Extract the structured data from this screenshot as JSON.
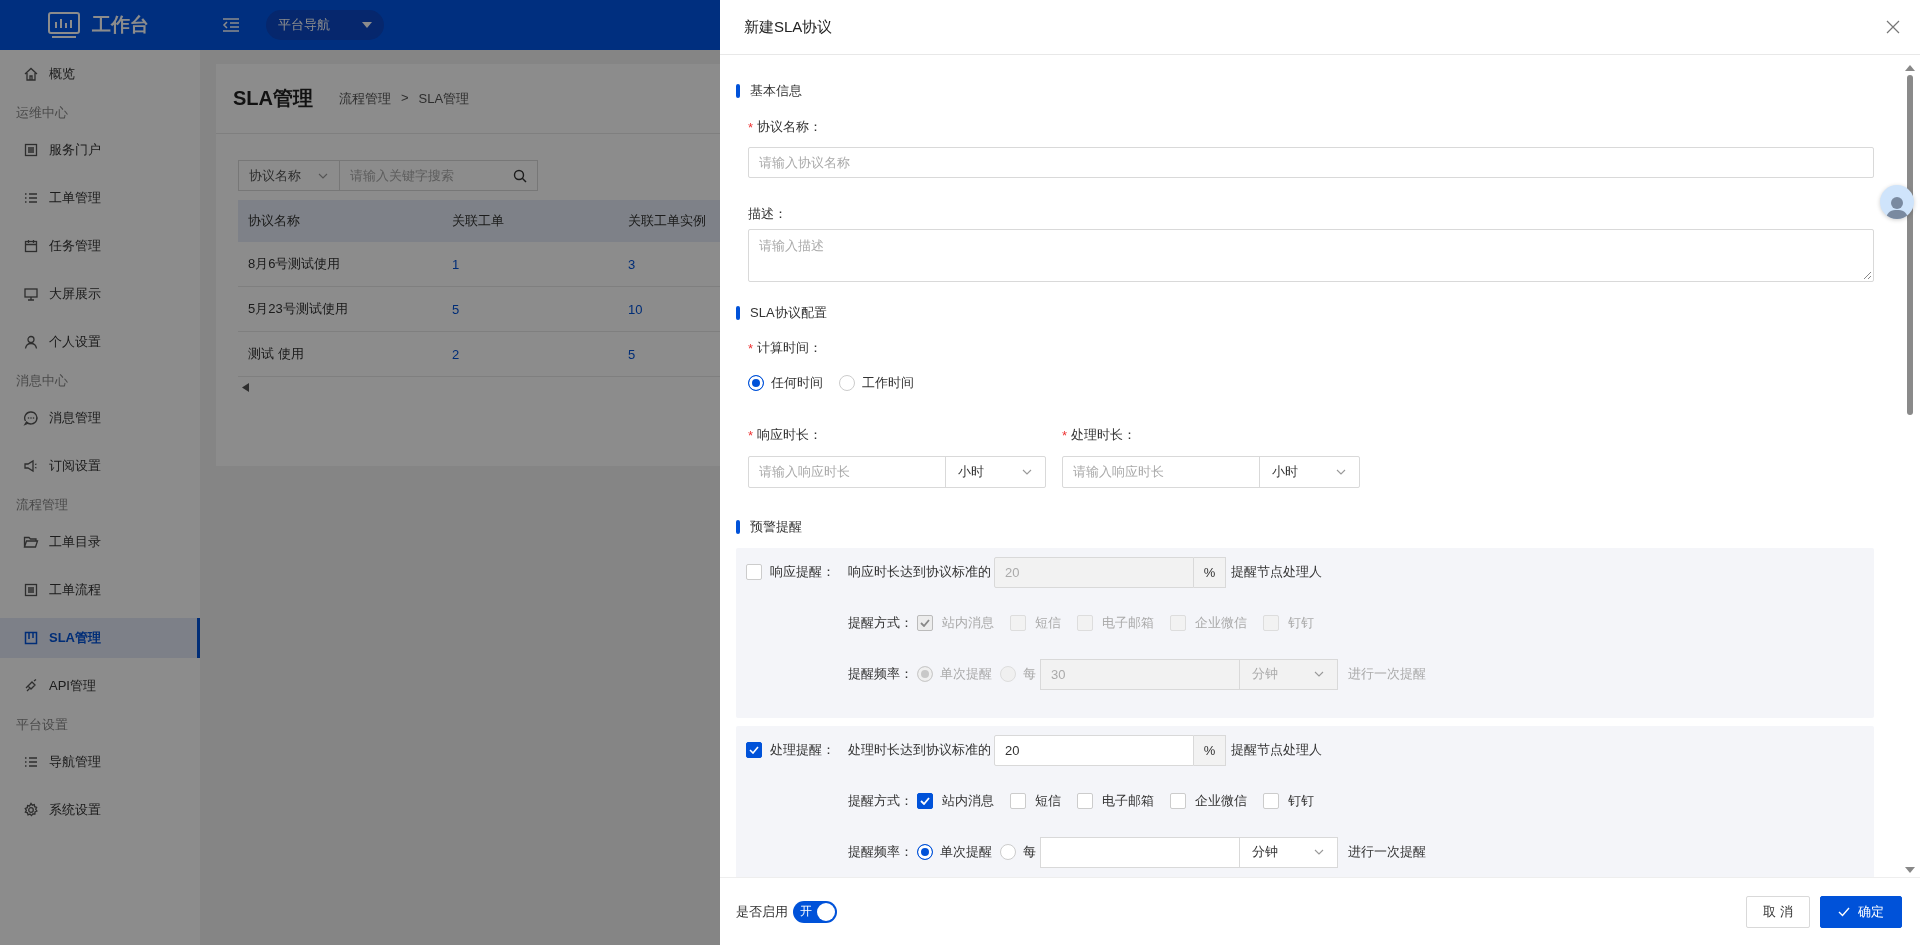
{
  "header": {
    "logo": "工作台",
    "nav_dropdown": "平台导航"
  },
  "sidebar": {
    "items": [
      {
        "kind": "item",
        "label": "概览",
        "selected": false
      },
      {
        "kind": "group",
        "label": "运维中心"
      },
      {
        "kind": "item",
        "label": "服务门户",
        "selected": false
      },
      {
        "kind": "item",
        "label": "工单管理",
        "selected": false
      },
      {
        "kind": "item",
        "label": "任务管理",
        "selected": false
      },
      {
        "kind": "item",
        "label": "大屏展示",
        "selected": false
      },
      {
        "kind": "item",
        "label": "个人设置",
        "selected": false
      },
      {
        "kind": "group",
        "label": "消息中心"
      },
      {
        "kind": "item",
        "label": "消息管理",
        "selected": false
      },
      {
        "kind": "item",
        "label": "订阅设置",
        "selected": false
      },
      {
        "kind": "group",
        "label": "流程管理"
      },
      {
        "kind": "item",
        "label": "工单目录",
        "selected": false
      },
      {
        "kind": "item",
        "label": "工单流程",
        "selected": false
      },
      {
        "kind": "item",
        "label": "SLA管理",
        "selected": true
      },
      {
        "kind": "item",
        "label": "API管理",
        "selected": false
      },
      {
        "kind": "group",
        "label": "平台设置"
      },
      {
        "kind": "item",
        "label": "导航管理",
        "selected": false
      },
      {
        "kind": "item",
        "label": "系统设置",
        "selected": false
      }
    ]
  },
  "page": {
    "title": "SLA管理",
    "breadcrumb": [
      "流程管理",
      "SLA管理"
    ],
    "breadcrumb_separator": ">",
    "search": {
      "field": "协议名称",
      "placeholder": "请输入关键字搜索"
    },
    "table": {
      "columns": [
        "协议名称",
        "关联工单",
        "关联工单实例"
      ],
      "rows": [
        [
          "8月6号测试使用",
          "1",
          "3"
        ],
        [
          "5月23号测试使用",
          "5",
          "10"
        ],
        [
          "测试 使用",
          "2",
          "5"
        ]
      ]
    }
  },
  "drawer": {
    "title": "新建SLA协议",
    "basic": {
      "title": "基本信息",
      "name_required": "*",
      "name_label": "协议名称：",
      "name_placeholder": "请输入协议名称",
      "desc_label": "描述：",
      "desc_placeholder": "请输入描述"
    },
    "config": {
      "title": "SLA协议配置",
      "time_required": "*",
      "time_label": "计算时间：",
      "time_options": [
        {
          "label": "任何时间",
          "selected": true
        },
        {
          "label": "工作时间",
          "selected": false
        }
      ],
      "durations": [
        {
          "required": "*",
          "label": "响应时长：",
          "placeholder": "请输入响应时长",
          "unit": "小时"
        },
        {
          "required": "*",
          "label": "处理时长：",
          "placeholder": "请输入响应时长",
          "unit": "小时"
        }
      ]
    },
    "alerts": {
      "title": "预警提醒",
      "items": [
        {
          "checked": false,
          "disabled": true,
          "label": "响应提醒：",
          "text": "响应时长达到协议标准的",
          "value": "20",
          "unit": "%",
          "suffix": "提醒节点处理人",
          "method_label": "提醒方式：",
          "methods": [
            {
              "label": "站内消息",
              "checked": true
            },
            {
              "label": "短信",
              "checked": false
            },
            {
              "label": "电子邮箱",
              "checked": false
            },
            {
              "label": "企业微信",
              "checked": false
            },
            {
              "label": "钉钉",
              "checked": false
            }
          ],
          "frequency_label": "提醒频率：",
          "frequency_options": [
            {
              "label": "单次提醒",
              "selected": true
            },
            {
              "label": "每",
              "selected": false
            }
          ],
          "interval_value": "30",
          "interval_unit": "分钟",
          "interval_suffix": "进行一次提醒"
        },
        {
          "checked": true,
          "disabled": false,
          "label": "处理提醒：",
          "text": "处理时长达到协议标准的",
          "value": "20",
          "unit": "%",
          "suffix": "提醒节点处理人",
          "method_label": "提醒方式：",
          "methods": [
            {
              "label": "站内消息",
              "checked": true
            },
            {
              "label": "短信",
              "checked": false
            },
            {
              "label": "电子邮箱",
              "checked": false
            },
            {
              "label": "企业微信",
              "checked": false
            },
            {
              "label": "钉钉",
              "checked": false
            }
          ],
          "frequency_label": "提醒频率：",
          "frequency_options": [
            {
              "label": "单次提醒",
              "selected": true
            },
            {
              "label": "每",
              "selected": false
            }
          ],
          "interval_unit": "分钟",
          "interval_suffix": "进行一次提醒"
        }
      ]
    },
    "footer": {
      "enable_label": "是否启用",
      "toggle": {
        "on": true,
        "label": "开"
      },
      "cancel": "取 消",
      "confirm": "确定"
    }
  }
}
